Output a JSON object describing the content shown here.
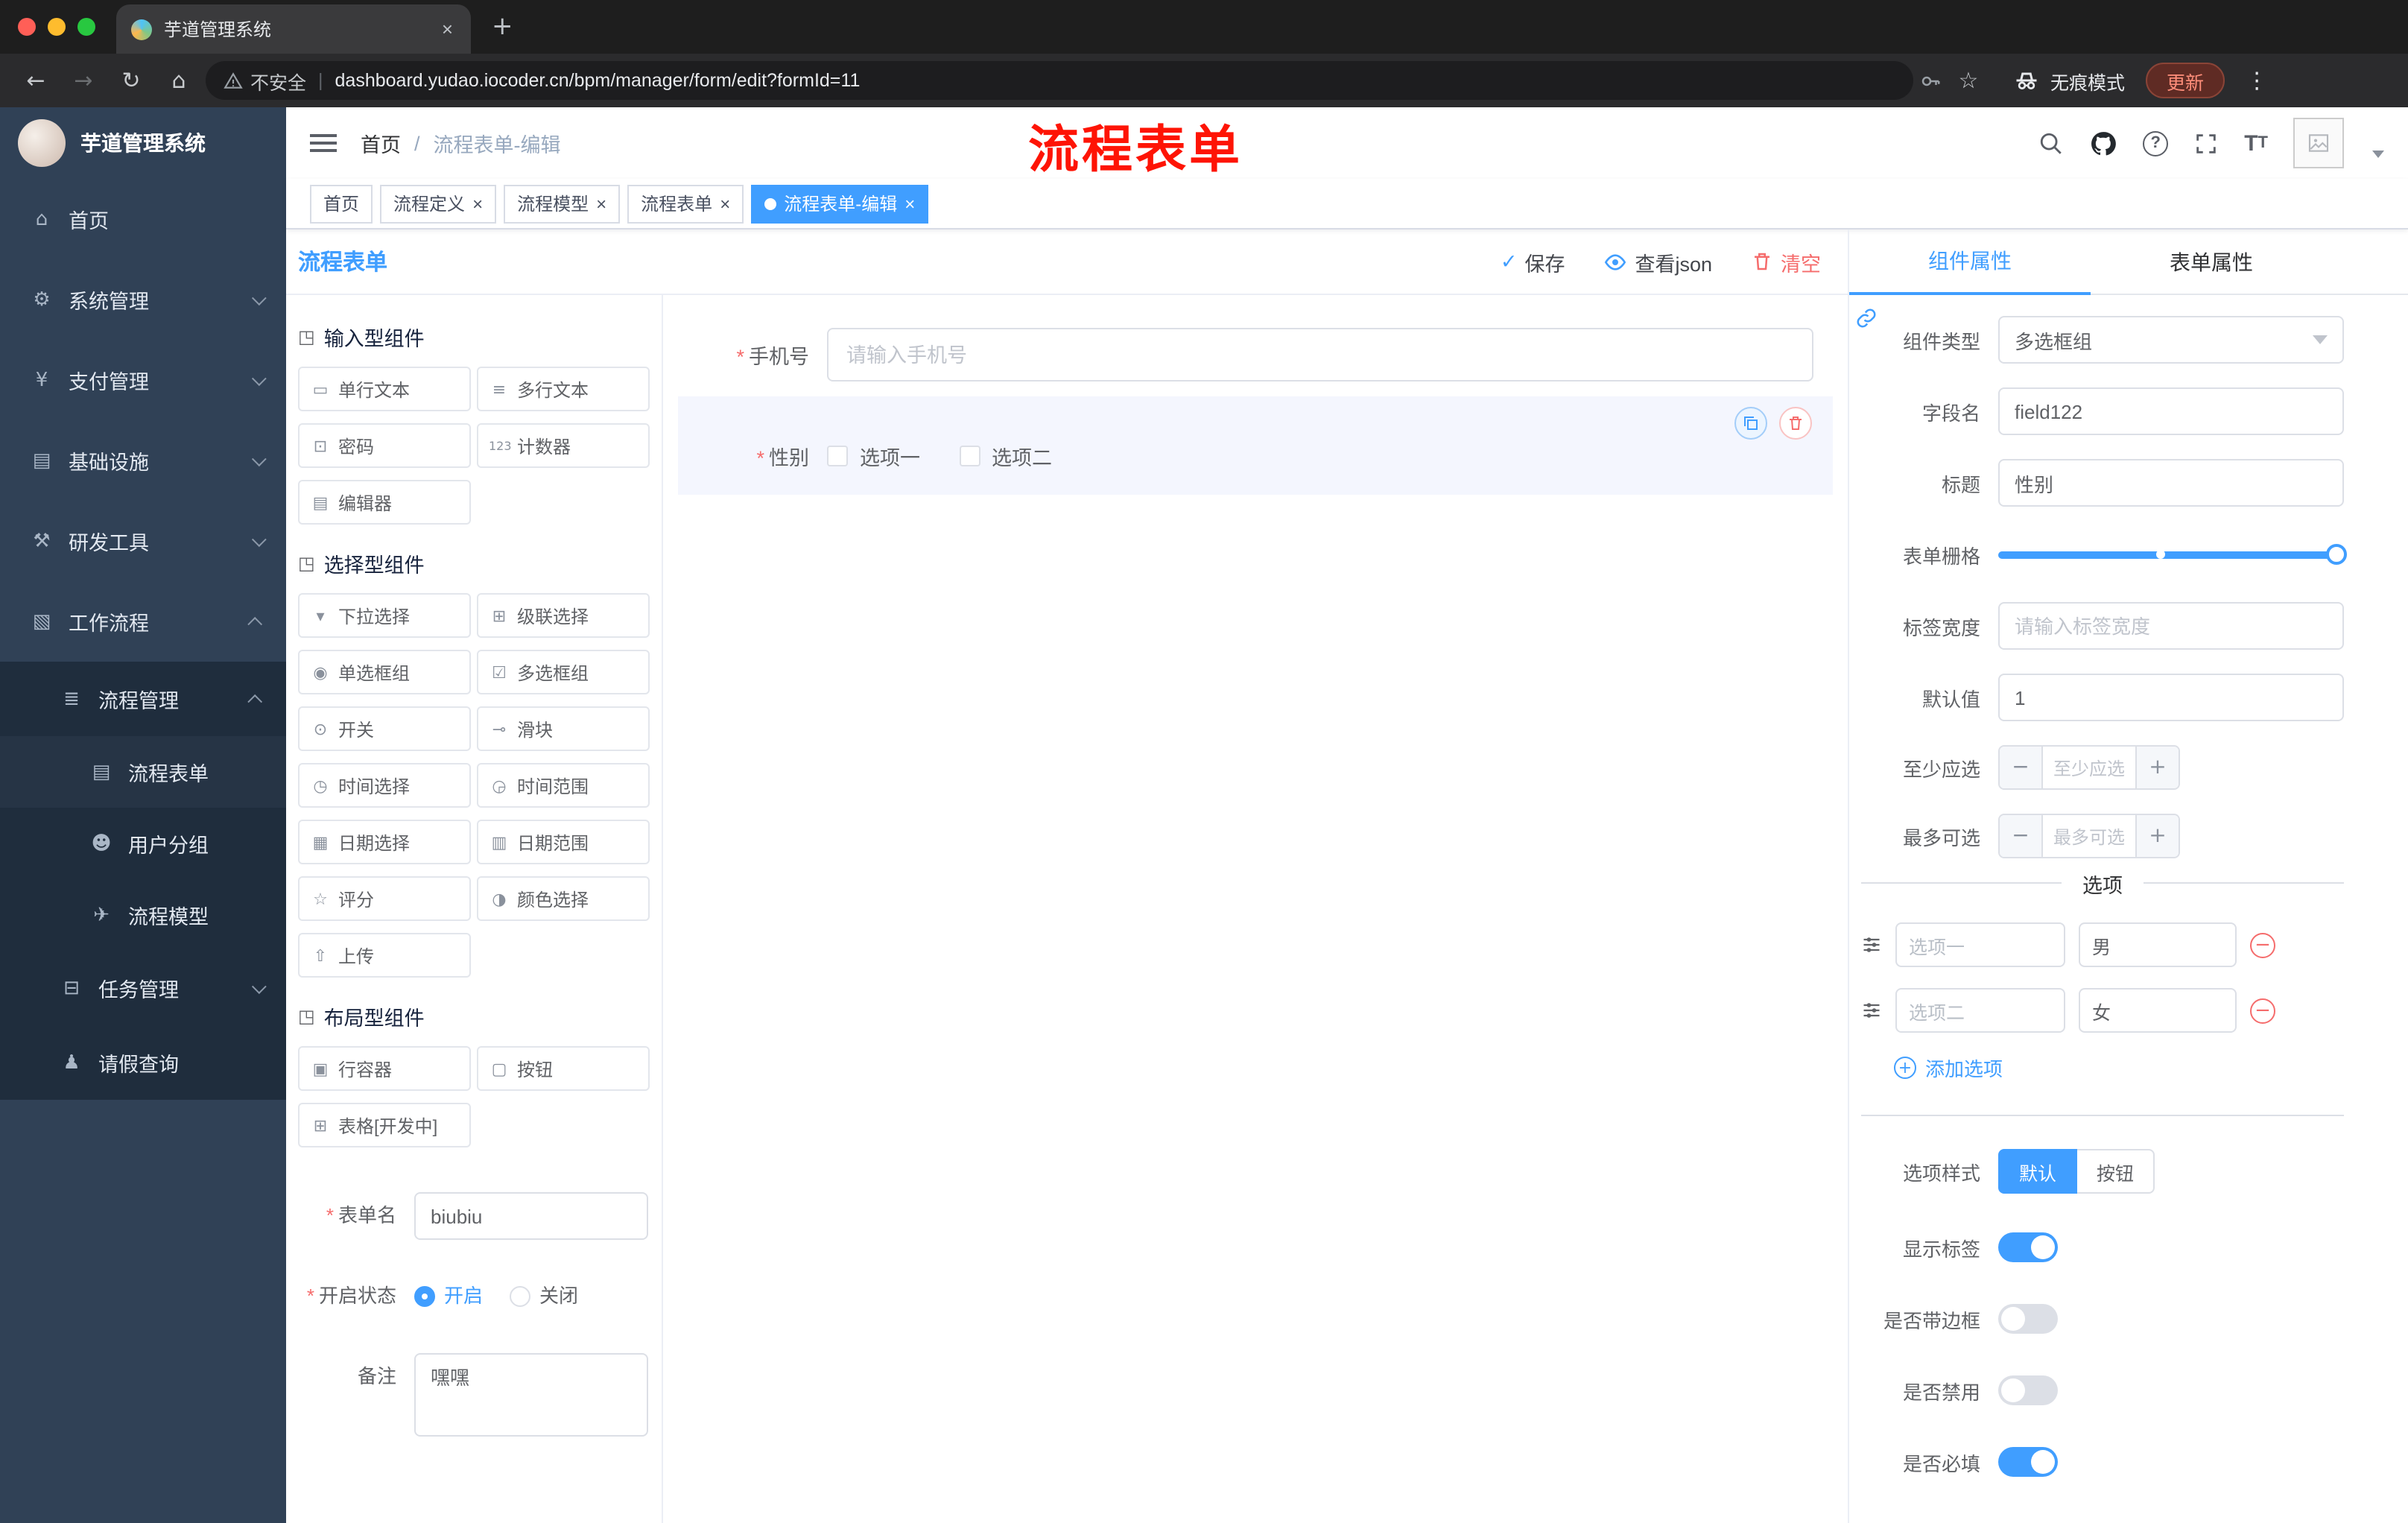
{
  "colors": {
    "accent": "#409eff",
    "danger": "#f56c6c",
    "sidebar": "#304156"
  },
  "browser": {
    "tab_title": "芋道管理系统",
    "security": "不安全",
    "url": "dashboard.yudao.iocoder.cn/bpm/manager/form/edit?formId=11",
    "incognito": "无痕模式",
    "update": "更新"
  },
  "annotation": "流程表单",
  "sidebar": {
    "logo_title": "芋道管理系统",
    "menu": [
      {
        "label": "首页"
      },
      {
        "label": "系统管理"
      },
      {
        "label": "支付管理"
      },
      {
        "label": "基础设施"
      },
      {
        "label": "研发工具"
      },
      {
        "label": "工作流程"
      },
      {
        "label": "流程管理"
      },
      {
        "label": "流程表单"
      },
      {
        "label": "用户分组"
      },
      {
        "label": "流程模型"
      },
      {
        "label": "任务管理"
      },
      {
        "label": "请假查询"
      }
    ]
  },
  "navbar": {
    "breadcrumb": [
      "首页",
      "流程表单-编辑"
    ]
  },
  "tags": [
    {
      "label": "首页"
    },
    {
      "label": "流程定义"
    },
    {
      "label": "流程模型"
    },
    {
      "label": "流程表单"
    },
    {
      "label": "流程表单-编辑"
    }
  ],
  "designer": {
    "title": "流程表单",
    "toolbar": {
      "save": "保存",
      "view_json": "查看json",
      "clear": "清空"
    },
    "groups": [
      {
        "title": "输入型组件",
        "items": [
          "单行文本",
          "多行文本",
          "密码",
          "计数器",
          "编辑器"
        ]
      },
      {
        "title": "选择型组件",
        "items": [
          "下拉选择",
          "级联选择",
          "单选框组",
          "多选框组",
          "开关",
          "滑块",
          "时间选择",
          "时间范围",
          "日期选择",
          "日期范围",
          "评分",
          "颜色选择",
          "上传"
        ]
      },
      {
        "title": "布局型组件",
        "items": [
          "行容器",
          "按钮",
          "表格[开发中]"
        ]
      }
    ],
    "form": {
      "name_label": "表单名",
      "name_value": "biubiu",
      "status_label": "开启状态",
      "status_on": "开启",
      "status_off": "关闭",
      "remark_label": "备注",
      "remark_value": "嘿嘿"
    }
  },
  "canvas": {
    "phone_label": "手机号",
    "phone_placeholder": "请输入手机号",
    "gender_label": "性别",
    "gender_options": [
      "选项一",
      "选项二"
    ]
  },
  "props": {
    "tabs": [
      "组件属性",
      "表单属性"
    ],
    "component_type_label": "组件类型",
    "component_type_value": "多选框组",
    "field_label": "字段名",
    "field_value": "field122",
    "title_label": "标题",
    "title_value": "性别",
    "grid_label": "表单栅格",
    "label_width_label": "标签宽度",
    "label_width_placeholder": "请输入标签宽度",
    "default_label": "默认值",
    "default_value": "1",
    "min_label": "至少应选",
    "min_placeholder": "至少应选",
    "max_label": "最多可选",
    "max_placeholder": "最多可选",
    "options_title": "选项",
    "options": [
      {
        "label": "选项一",
        "value": "男"
      },
      {
        "label": "选项二",
        "value": "女"
      }
    ],
    "add_option": "添加选项",
    "style_label": "选项样式",
    "style_default": "默认",
    "style_button": "按钮",
    "switch_show_label": "显示标签",
    "switch_border_label": "是否带边框",
    "switch_disabled_label": "是否禁用",
    "switch_required_label": "是否必填"
  }
}
